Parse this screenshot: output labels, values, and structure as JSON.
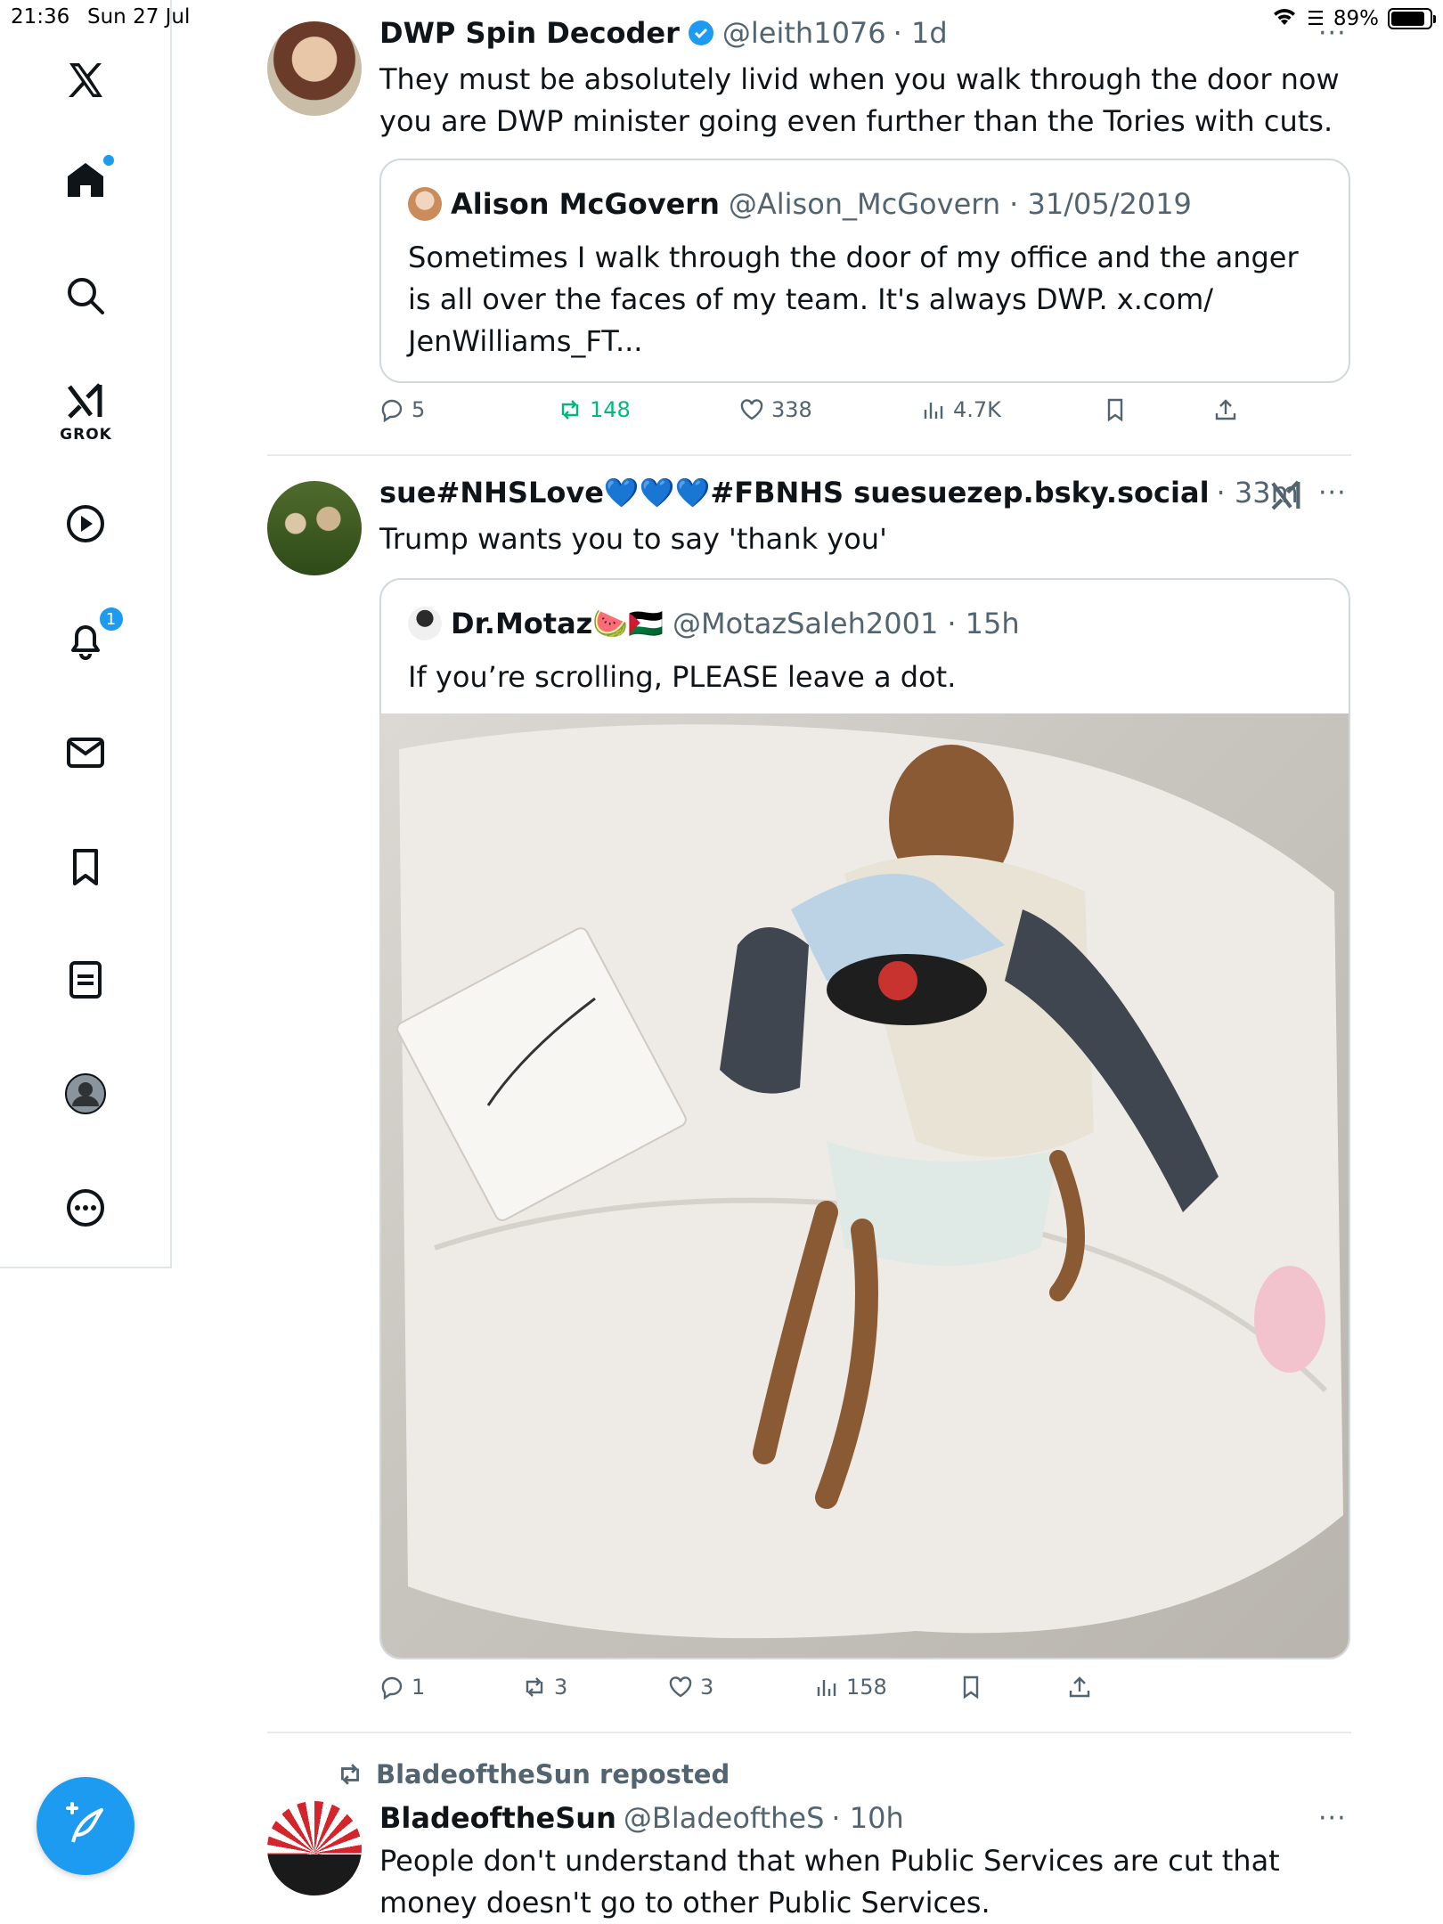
{
  "status_bar": {
    "time": "21:36",
    "date": "Sun 27 Jul",
    "battery": "89%",
    "battery_level": 0.89
  },
  "sidebar": {
    "items": [
      {
        "name": "x-logo-icon"
      },
      {
        "name": "home-icon",
        "notification_dot": true
      },
      {
        "name": "search-icon"
      },
      {
        "name": "grok-icon",
        "label": "GROK"
      },
      {
        "name": "video-icon"
      },
      {
        "name": "notifications-icon",
        "badge": "1"
      },
      {
        "name": "messages-icon"
      },
      {
        "name": "bookmarks-icon"
      },
      {
        "name": "lists-icon"
      },
      {
        "name": "profile-icon"
      },
      {
        "name": "more-icon"
      }
    ],
    "compose_icon": "compose-icon"
  },
  "posts": [
    {
      "name": "DWP Spin Decoder",
      "verified": true,
      "handle": "@leith1076",
      "time": "· 1d",
      "text": "They must be absolutely livid when you walk through the door now you are DWP minister going even further than the Tories with cuts.",
      "quote": {
        "name": "Alison McGovern",
        "handle": "@Alison_McGovern",
        "time": "· 31/05/2019",
        "text": "Sometimes I walk through the door of my office and the anger is all over the faces of my team. It's always DWP. x.com/ JenWilliams_FT..."
      },
      "actions": {
        "replies": "5",
        "reposts": "148",
        "likes": "338",
        "views": "4.7K"
      }
    },
    {
      "name": "sue#NHSLove💙💙💙#FBNHS suesuezep.bsky.social",
      "time": "· 33m",
      "text": "Trump wants you to say 'thank you'",
      "quote": {
        "name": "Dr.Motaz🍉🇵🇸",
        "handle": "@MotazSaleh2001",
        "time": "· 15h",
        "text": "If you’re scrolling, PLEASE leave a dot."
      },
      "actions": {
        "replies": "1",
        "reposts": "3",
        "likes": "3",
        "views": "158"
      }
    },
    {
      "repost_label": "BladeoftheSun reposted",
      "name": "BladeoftheSun",
      "handle": "@BladeoftheS",
      "time": "· 10h",
      "text": "People don't understand that when Public Services are cut that money doesn't go to other Public Services."
    }
  ],
  "colors": {
    "accent": "#1d9bf0",
    "repost_active": "#00ba7c",
    "text": "#0f1419",
    "muted": "#536471",
    "border": "#cfd9de"
  }
}
